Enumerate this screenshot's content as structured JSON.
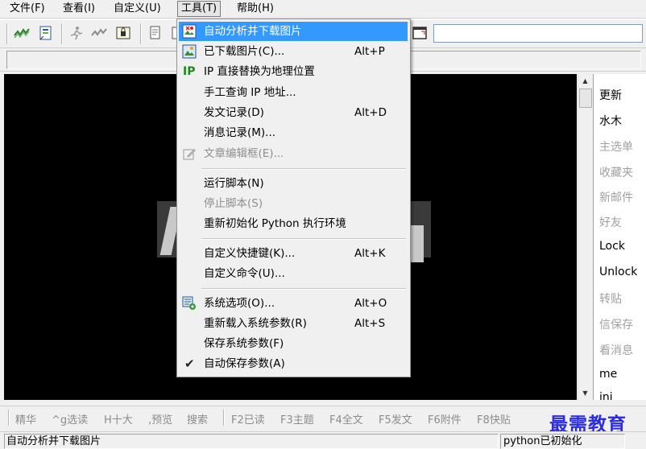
{
  "menubar": {
    "items": [
      {
        "label": "文件(F)"
      },
      {
        "label": "查看(I)"
      },
      {
        "label": "自定义(U)"
      },
      {
        "label": "工具(T)"
      },
      {
        "label": "帮助(H)"
      }
    ]
  },
  "tools_menu": {
    "items": [
      {
        "label": "自动分析并下载图片",
        "shortcut": "",
        "icon": "image-download-icon",
        "state": "highlighted"
      },
      {
        "label": "已下载图片(C)...",
        "shortcut": "Alt+P",
        "icon": "picture-icon",
        "state": "enabled"
      },
      {
        "label": "IP 直接替换为地理位置",
        "shortcut": "",
        "icon": "ip-icon",
        "icon_text": "IP",
        "state": "enabled"
      },
      {
        "label": "手工查询 IP 地址...",
        "shortcut": "",
        "icon": "",
        "state": "enabled"
      },
      {
        "label": "发文记录(D)",
        "shortcut": "Alt+D",
        "icon": "",
        "state": "enabled"
      },
      {
        "label": "消息记录(M)...",
        "shortcut": "",
        "icon": "",
        "state": "enabled"
      },
      {
        "label": "文章编辑框(E)...",
        "shortcut": "",
        "icon": "edit-icon",
        "state": "disabled"
      },
      {
        "label": "运行脚本(N)",
        "shortcut": "",
        "icon": "",
        "state": "enabled"
      },
      {
        "label": "停止脚本(S)",
        "shortcut": "",
        "icon": "",
        "state": "disabled"
      },
      {
        "label": "重新初始化 Python 执行环境",
        "shortcut": "",
        "icon": "",
        "state": "enabled"
      },
      {
        "label": "自定义快捷键(K)...",
        "shortcut": "Alt+K",
        "icon": "",
        "state": "enabled"
      },
      {
        "label": "自定义命令(U)...",
        "shortcut": "",
        "icon": "",
        "state": "enabled"
      },
      {
        "label": "系统选项(O)...",
        "shortcut": "Alt+O",
        "icon": "settings-icon",
        "state": "enabled"
      },
      {
        "label": "重新载入系统参数(R)",
        "shortcut": "Alt+S",
        "icon": "",
        "state": "enabled"
      },
      {
        "label": "保存系统参数(F)",
        "shortcut": "",
        "icon": "",
        "state": "enabled"
      },
      {
        "label": "自动保存参数(A)",
        "shortcut": "",
        "icon": "check-icon",
        "icon_text": "✔",
        "state": "checked"
      }
    ]
  },
  "side_panel": {
    "items": [
      {
        "label": "更新",
        "state": "enabled"
      },
      {
        "label": "水木",
        "state": "enabled"
      },
      {
        "label": "主选单",
        "state": "disabled"
      },
      {
        "label": "收藏夹",
        "state": "disabled"
      },
      {
        "label": "新邮件",
        "state": "disabled"
      },
      {
        "label": "好友",
        "state": "disabled"
      },
      {
        "label": "Lock",
        "state": "enabled"
      },
      {
        "label": "Unlock",
        "state": "enabled"
      },
      {
        "label": "转贴",
        "state": "disabled"
      },
      {
        "label": "信保存",
        "state": "disabled"
      },
      {
        "label": "看消息",
        "state": "disabled"
      },
      {
        "label": "me",
        "state": "enabled"
      },
      {
        "label": "ini",
        "state": "enabled"
      }
    ]
  },
  "function_bar": {
    "items": [
      {
        "label": "精华"
      },
      {
        "label": "^g选读"
      },
      {
        "label": "H十大"
      },
      {
        "label": ",预览"
      },
      {
        "label": "搜索"
      },
      {
        "label": "F2已读"
      },
      {
        "label": "F3主题"
      },
      {
        "label": "F4全文"
      },
      {
        "label": "F5发文"
      },
      {
        "label": "F6附件"
      },
      {
        "label": "F8快贴"
      }
    ]
  },
  "watermark": {
    "text": "最需教育"
  },
  "status": {
    "left": "自动分析并下载图片",
    "right": "python已初始化"
  },
  "colors": {
    "highlight": "#3399ff",
    "terminal_bg": "#000000",
    "watermark": "#2c2ce0",
    "ip_icon": "#1a8a1a"
  }
}
